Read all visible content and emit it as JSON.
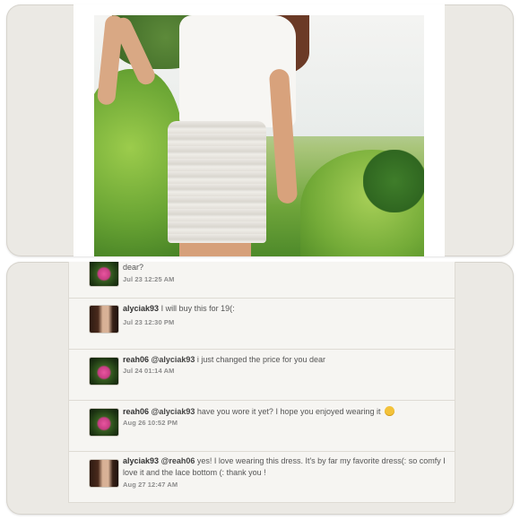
{
  "comments": [
    {
      "user": "",
      "mention": "",
      "text": "dear?",
      "time": "Jul 23 12:25 AM",
      "avatar": "lotus-avatar"
    },
    {
      "user": "alyciak93",
      "mention": "",
      "text": "I will buy this for 19(:",
      "time": "Jul 23 12:30 PM",
      "avatar": "girl-avatar"
    },
    {
      "user": "reah06",
      "mention": "@alyciak93",
      "text": "i just changed the price for you dear",
      "time": "Jul 24 01:14 AM",
      "avatar": "lotus-avatar"
    },
    {
      "user": "reah06",
      "mention": "@alyciak93",
      "text": "have you wore it yet? I hope you enjoyed wearing it",
      "time": "Aug 26 10:52 PM",
      "avatar": "lotus-avatar",
      "emoji": "smiley-emoji"
    },
    {
      "user": "alyciak93",
      "mention": "@reah06",
      "text": "yes! I love wearing this dress. It's by far my favorite dress(: so comfy I love it and the lace bottom (: thank you !",
      "time": "Aug 27 12:47 AM",
      "avatar": "girl-avatar"
    }
  ],
  "colors": {
    "panel": "#ebe9e4",
    "card": "#f6f5f2",
    "timestamp": "#8c8c8c"
  }
}
